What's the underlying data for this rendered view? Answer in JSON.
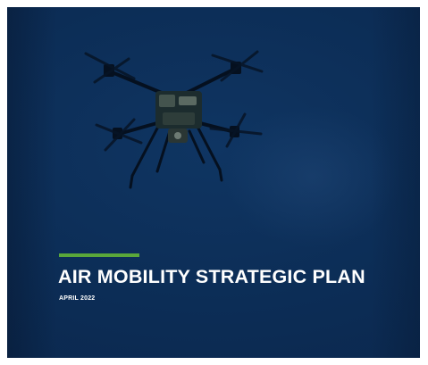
{
  "document": {
    "title": "AIR MOBILITY STRATEGIC PLAN",
    "date": "APRIL 2022"
  },
  "colors": {
    "background": "#0c2d56",
    "accent": "#5aa83a",
    "text": "#ffffff"
  },
  "images": {
    "cover_photo": "drone-icon"
  }
}
